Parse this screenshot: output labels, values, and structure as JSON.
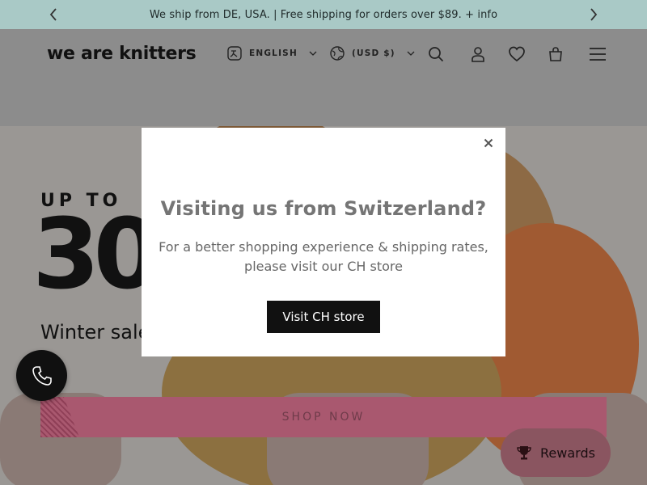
{
  "announcement": {
    "text": "We ship from DE, USA. | Free shipping for orders over $89. + info",
    "prev_icon": "chevron-left-icon",
    "next_icon": "chevron-right-icon"
  },
  "header": {
    "logo": "we are knitters",
    "language": "ENGLISH",
    "currency": "(USD $)",
    "icons": [
      "translate-icon",
      "globe-icon",
      "search-icon",
      "user-icon",
      "heart-icon",
      "bag-icon",
      "menu-icon"
    ]
  },
  "hero": {
    "eyebrow": "UP TO",
    "big_text": "30",
    "sale_text": "Winter sale  y hobby at the best price!",
    "cta": "SHOP NOW"
  },
  "modal": {
    "title": "Visiting us from Switzerland?",
    "body": "For a better shopping experience & shipping rates, please visit our CH store",
    "button": "Visit CH store",
    "close_icon": "close-icon"
  },
  "widgets": {
    "phone_icon": "phone-icon",
    "rewards_label": "Rewards",
    "rewards_icon": "trophy-icon"
  },
  "colors": {
    "announcement_bg": "#a9c9c6",
    "cta_bg": "#a9586f",
    "rewards_bg": "#8a5560",
    "modal_button_bg": "#111111"
  }
}
